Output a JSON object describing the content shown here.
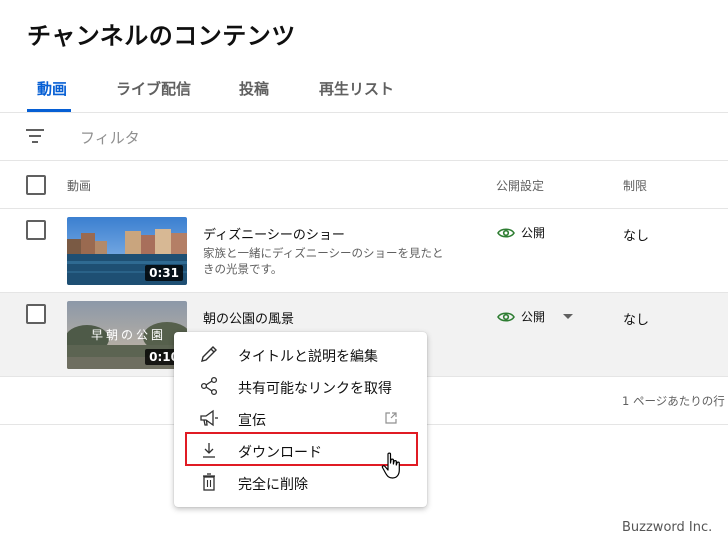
{
  "page": {
    "title": "チャンネルのコンテンツ"
  },
  "tabs": [
    {
      "label": "動画",
      "active": true
    },
    {
      "label": "ライブ配信",
      "active": false
    },
    {
      "label": "投稿",
      "active": false
    },
    {
      "label": "再生リスト",
      "active": false
    }
  ],
  "filter": {
    "label": "フィルタ",
    "icon": "filter-lines-icon"
  },
  "table": {
    "headers": {
      "video": "動画",
      "visibility": "公開設定",
      "restrictions": "制限"
    },
    "rows": [
      {
        "title": "ディズニーシーのショー",
        "description": "家族と一緒にディズニーシーのショーを見たときの光景です。",
        "duration": "0:31",
        "visibility": "公開",
        "restrictions": "なし"
      },
      {
        "title": "朝の公園の風景",
        "description": "",
        "duration": "0:10",
        "thumb_text": "早朝の公園",
        "visibility": "公開",
        "restrictions": "なし"
      }
    ]
  },
  "pagination": {
    "rows_per_page_label": "1 ページあたりの行"
  },
  "context_menu": {
    "items": [
      {
        "label": "タイトルと説明を編集",
        "icon": "pencil-icon"
      },
      {
        "label": "共有可能なリンクを取得",
        "icon": "share-icon"
      },
      {
        "label": "宣伝",
        "icon": "megaphone-icon",
        "trailing_icon": "external-link-icon"
      },
      {
        "label": "ダウンロード",
        "icon": "download-icon",
        "highlighted": true
      },
      {
        "label": "完全に削除",
        "icon": "trash-icon"
      }
    ]
  },
  "colors": {
    "accent": "#065fd4",
    "visibility_icon": "#2e7d32",
    "highlight_border": "#e01b24"
  },
  "watermark": "Buzzword Inc."
}
